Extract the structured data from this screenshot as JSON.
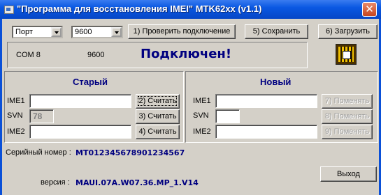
{
  "window": {
    "title": "\"Программа для восстановления IMEI\" MTK62xx (v1.1)",
    "close_glyph": "✕",
    "title_icon": "app-icon"
  },
  "toolbar": {
    "port_value": "Порт",
    "baud_value": "9600",
    "check_label": "1) Проверить подключение",
    "save_label": "5) Сохранить",
    "load_label": "6) Загрузить"
  },
  "status": {
    "com": "COM  8",
    "baud": "9600",
    "message": "Подключен!"
  },
  "old_group": {
    "title": "Старый",
    "imei1_label": "IME1",
    "svn_label": "SVN",
    "imei2_label": "IME2",
    "imei1_value": "",
    "svn_value": "78",
    "imei2_value": "",
    "read1_label": "2) Считать",
    "read2_label": "3) Считать",
    "read3_label": "4) Считать"
  },
  "new_group": {
    "title": "Новый",
    "imei1_label": "IME1",
    "svn_label": "SVN",
    "imei2_label": "IME2",
    "imei1_value": "",
    "svn_value": "",
    "imei2_value": "",
    "change1_label": "7) Поменять",
    "change2_label": "8) Поменять",
    "change3_label": "9) Поменять"
  },
  "info": {
    "serial_label": "Серийный номер :",
    "serial_value": "MT012345678901234567",
    "version_label": "версия :",
    "version_value": "MAUI.07A.W07.36.MP_1.V14"
  },
  "exit_label": "Выход"
}
